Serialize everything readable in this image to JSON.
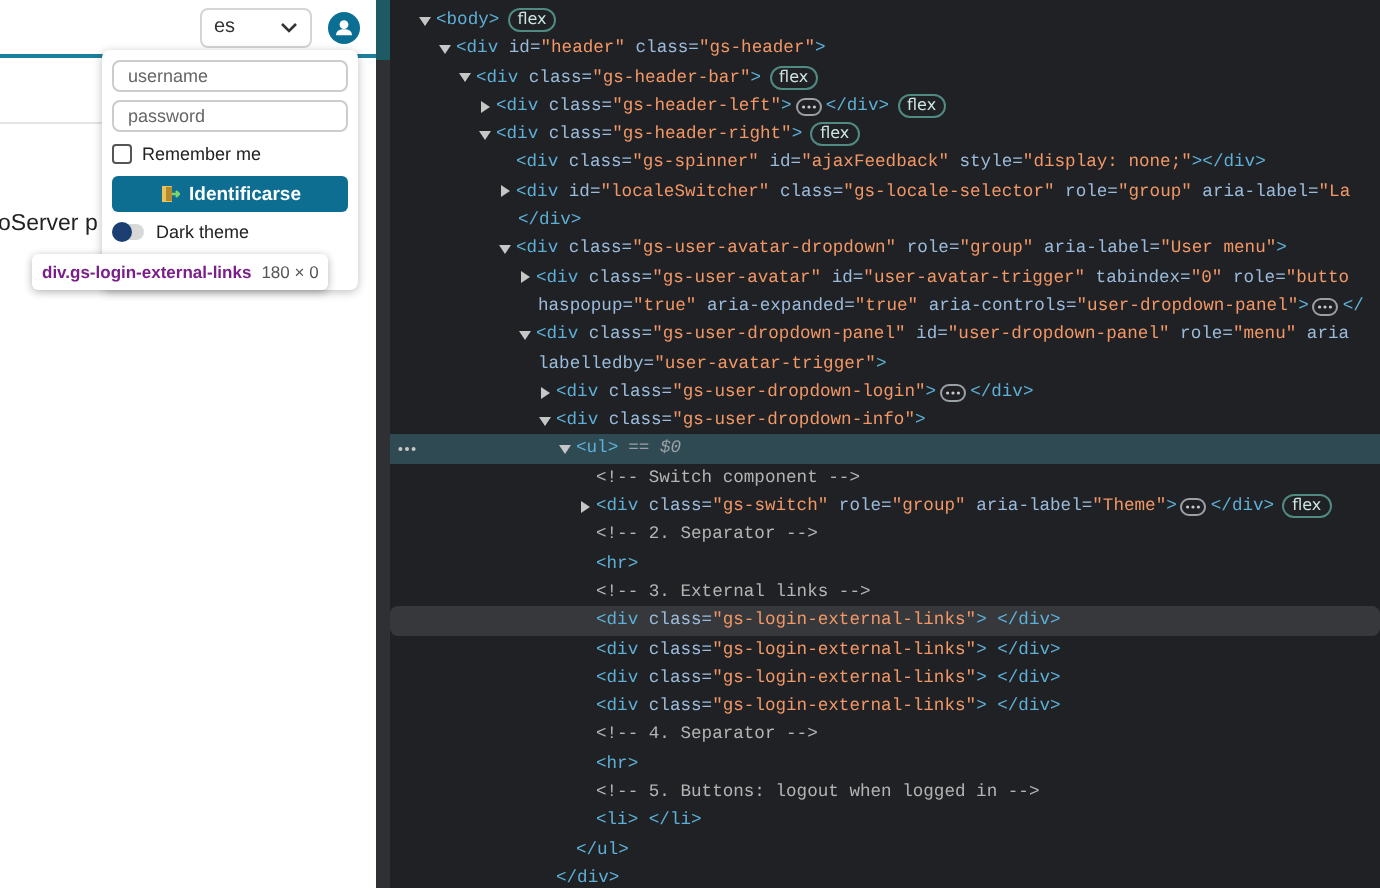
{
  "web_page": {
    "language_select": {
      "value": "es"
    },
    "page_text": "oServer p",
    "login_menu": {
      "username": {
        "placeholder": "username"
      },
      "password": {
        "placeholder": "password"
      },
      "remember_me": {
        "label": "Remember me",
        "checked": false
      },
      "login_button": "Identificarse",
      "dark_theme": {
        "label": "Dark theme",
        "on": false
      }
    },
    "inspect_tooltip": {
      "selector": "div.gs-login-external-links",
      "size": "180 × 0"
    }
  },
  "selected_marker": "== $0",
  "dom_tree": [
    {
      "kind": "element",
      "lines": [
        "<body>"
      ],
      "badge": "flex",
      "expanded": true,
      "selected": false,
      "hovered": false,
      "children": [
        {
          "kind": "element",
          "lines": [
            "<div id=\"header\" class=\"gs-header\">"
          ],
          "expanded": true,
          "selected": false,
          "hovered": false,
          "children": [
            {
              "kind": "element",
              "lines": [
                "<div class=\"gs-header-bar\">"
              ],
              "badge": "flex",
              "expanded": true,
              "selected": false,
              "hovered": false,
              "children": [
                {
                  "kind": "element",
                  "lines": [
                    "<div class=\"gs-header-left\">"
                  ],
                  "ellipsis": true,
                  "inline_close": "</div>",
                  "badge": "flex",
                  "expanded": false,
                  "selected": false,
                  "hovered": false
                },
                {
                  "kind": "element",
                  "lines": [
                    "<div class=\"gs-header-right\">"
                  ],
                  "badge": "flex",
                  "expanded": true,
                  "selected": false,
                  "hovered": false,
                  "children": [
                    {
                      "kind": "element",
                      "lines": [
                        "<div class=\"gs-spinner\" id=\"ajaxFeedback\" style=\"display: none;\"></div>"
                      ],
                      "selected": false,
                      "hovered": false
                    },
                    {
                      "kind": "element",
                      "lines": [
                        "<div id=\"localeSwitcher\" class=\"gs-locale-selector\" role=\"group\" aria-label=\"La",
                        "</div>"
                      ],
                      "expanded": false,
                      "selected": false,
                      "hovered": false
                    },
                    {
                      "kind": "element",
                      "lines": [
                        "<div class=\"gs-user-avatar-dropdown\" role=\"group\" aria-label=\"User menu\">"
                      ],
                      "expanded": true,
                      "selected": false,
                      "hovered": false,
                      "children": [
                        {
                          "kind": "element",
                          "lines": [
                            "<div class=\"gs-user-avatar\" id=\"user-avatar-trigger\" tabindex=\"0\" role=\"butto",
                            "haspopup=\"true\" aria-expanded=\"true\" aria-controls=\"user-dropdown-panel\">"
                          ],
                          "ellipsis": true,
                          "inline_close": "</",
                          "expanded": false,
                          "selected": false,
                          "hovered": false
                        },
                        {
                          "kind": "element",
                          "lines": [
                            "<div class=\"gs-user-dropdown-panel\" id=\"user-dropdown-panel\" role=\"menu\" aria",
                            "labelledby=\"user-avatar-trigger\">"
                          ],
                          "expanded": true,
                          "selected": false,
                          "hovered": false,
                          "children": [
                            {
                              "kind": "element",
                              "lines": [
                                "<div class=\"gs-user-dropdown-login\">"
                              ],
                              "ellipsis": true,
                              "inline_close": "</div>",
                              "expanded": false,
                              "selected": false,
                              "hovered": false
                            },
                            {
                              "kind": "element",
                              "lines": [
                                "<div class=\"gs-user-dropdown-info\">"
                              ],
                              "expanded": true,
                              "close": "</div>",
                              "selected": false,
                              "hovered": false,
                              "children": [
                                {
                                  "kind": "element",
                                  "lines": [
                                    "<ul>"
                                  ],
                                  "expanded": true,
                                  "close": "</ul>",
                                  "selected": true,
                                  "hovered": false,
                                  "children": [
                                    {
                                      "kind": "comment",
                                      "lines": [
                                        "<!-- Switch component -->"
                                      ],
                                      "selected": false,
                                      "hovered": false
                                    },
                                    {
                                      "kind": "element",
                                      "lines": [
                                        "<div class=\"gs-switch\" role=\"group\" aria-label=\"Theme\">"
                                      ],
                                      "ellipsis": true,
                                      "inline_close": "</div>",
                                      "badge": "flex",
                                      "expanded": false,
                                      "selected": false,
                                      "hovered": false
                                    },
                                    {
                                      "kind": "comment",
                                      "lines": [
                                        "<!-- 2. Separator -->"
                                      ],
                                      "selected": false,
                                      "hovered": false
                                    },
                                    {
                                      "kind": "element",
                                      "lines": [
                                        "<hr>"
                                      ],
                                      "selected": false,
                                      "hovered": false
                                    },
                                    {
                                      "kind": "comment",
                                      "lines": [
                                        "<!-- 3. External links -->"
                                      ],
                                      "selected": false,
                                      "hovered": false
                                    },
                                    {
                                      "kind": "element",
                                      "lines": [
                                        "<div class=\"gs-login-external-links\"> </div>"
                                      ],
                                      "selected": false,
                                      "hovered": true
                                    },
                                    {
                                      "kind": "element",
                                      "lines": [
                                        "<div class=\"gs-login-external-links\"> </div>"
                                      ],
                                      "selected": false,
                                      "hovered": false
                                    },
                                    {
                                      "kind": "element",
                                      "lines": [
                                        "<div class=\"gs-login-external-links\"> </div>"
                                      ],
                                      "selected": false,
                                      "hovered": false
                                    },
                                    {
                                      "kind": "element",
                                      "lines": [
                                        "<div class=\"gs-login-external-links\"> </div>"
                                      ],
                                      "selected": false,
                                      "hovered": false
                                    },
                                    {
                                      "kind": "comment",
                                      "lines": [
                                        "<!-- 4. Separator -->"
                                      ],
                                      "selected": false,
                                      "hovered": false
                                    },
                                    {
                                      "kind": "element",
                                      "lines": [
                                        "<hr>"
                                      ],
                                      "selected": false,
                                      "hovered": false
                                    },
                                    {
                                      "kind": "comment",
                                      "lines": [
                                        "<!-- 5. Buttons: logout when logged in -->"
                                      ],
                                      "selected": false,
                                      "hovered": false
                                    },
                                    {
                                      "kind": "element",
                                      "lines": [
                                        "<li> </li>"
                                      ],
                                      "selected": false,
                                      "hovered": false
                                    }
                                  ]
                                }
                              ]
                            }
                          ]
                        }
                      ]
                    }
                  ]
                }
              ]
            }
          ]
        }
      ]
    }
  ]
}
